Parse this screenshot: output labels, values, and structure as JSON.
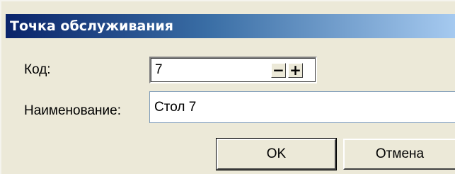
{
  "dialog": {
    "title": "Точка обслуживания"
  },
  "form": {
    "code_label": "Код:",
    "code_value": "7",
    "decrement_label": "−",
    "increment_label": "+",
    "name_label": "Наименование:",
    "name_value": "Стол 7"
  },
  "buttons": {
    "ok_label": "OK",
    "cancel_label": "Отмена"
  },
  "colors": {
    "title_bar_start": "#0a246a",
    "title_bar_end": "#a6caf0",
    "dialog_background": "#ece9d8"
  }
}
